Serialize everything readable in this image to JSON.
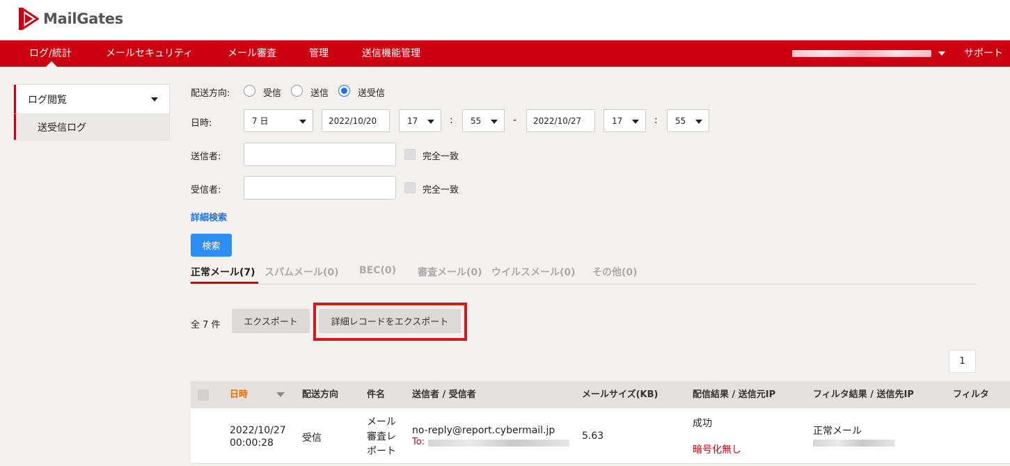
{
  "app": {
    "name": "MailGates",
    "brand_color": "#cc0011",
    "accent_color": "#1a73e8"
  },
  "nav": {
    "items": [
      {
        "label": "ログ/統計",
        "active": true
      },
      {
        "label": "メールセキュリティ"
      },
      {
        "label": "メール審査"
      },
      {
        "label": "管理"
      },
      {
        "label": "送信機能管理"
      }
    ],
    "support_label": "サポート"
  },
  "sidebar": {
    "section_label": "ログ閲覧",
    "sub_item_label": "送受信ログ"
  },
  "form": {
    "direction_label": "配送方向:",
    "direction_options": [
      "受信",
      "送信",
      "送受信"
    ],
    "direction_selected": "送受信",
    "date_label": "日時:",
    "period_value": "7 日",
    "start_date": "2022/10/20",
    "start_hour": "17",
    "start_minute": "55",
    "end_date": "2022/10/27",
    "end_hour": "17",
    "end_minute": "55",
    "colon": ":",
    "range_sep": "-",
    "sender_label": "送信者:",
    "receiver_label": "受信者:",
    "exact_match_label": "完全一致",
    "advanced_search_label": "詳細検索",
    "search_button_label": "検索"
  },
  "tabs": [
    {
      "label": "正常メール(7)",
      "active": true
    },
    {
      "label": "スパムメール(0)"
    },
    {
      "label": "BEC(0)"
    },
    {
      "label": "審査メール(0)"
    },
    {
      "label": "ウイルスメール(0)"
    },
    {
      "label": "その他(0)"
    }
  ],
  "results": {
    "count_label": "全 7 件",
    "export_label": "エクスポート",
    "export_detail_label": "詳細レコードをエクスポート",
    "page_number": "1"
  },
  "table": {
    "headers": {
      "datetime": "日時",
      "direction": "配送方向",
      "subject": "件名",
      "sender_receiver": "送信者 / 受信者",
      "size": "メールサイズ(KB)",
      "delivery": "配信結果 / 送信元IP",
      "filter_result": "フィルタ結果 / 送信先IP",
      "filter": "フィルタ"
    },
    "rows": [
      {
        "date": "2022/10/27",
        "time": "00:00:28",
        "direction": "受信",
        "subject_lines": [
          "メール",
          "審査レ",
          "ポート"
        ],
        "sender": "no-reply@report.cybermail.jp",
        "to_prefix": "To:",
        "size": "5.63",
        "delivery_status": "成功",
        "encryption": "暗号化無し",
        "filter_result": "正常メール"
      }
    ]
  }
}
